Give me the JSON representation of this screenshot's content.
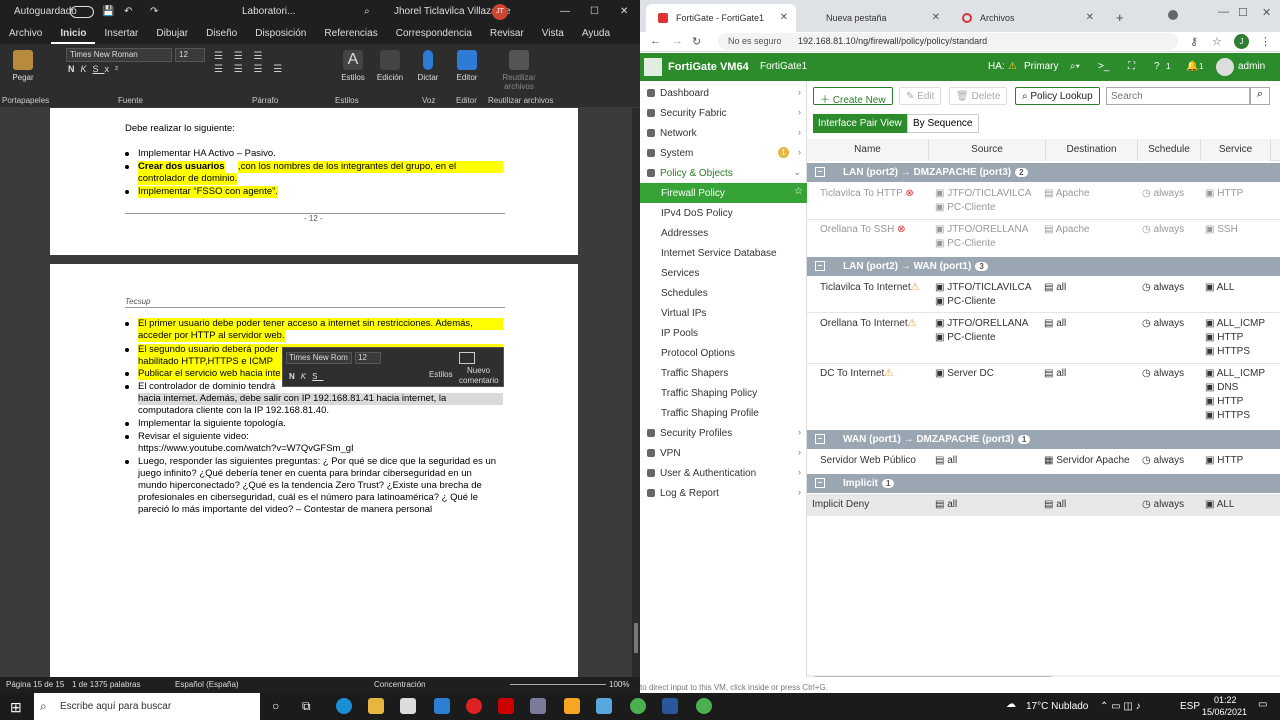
{
  "word": {
    "title": {
      "autosave": "Autoguardado",
      "doc": "Laboratori...",
      "user": "Jhorel Ticlavilca Villazante",
      "initials": "JT"
    },
    "tabs": [
      "Archivo",
      "Inicio",
      "Insertar",
      "Dibujar",
      "Diseño",
      "Disposición",
      "Referencias",
      "Correspondencia",
      "Revisar",
      "Vista",
      "Ayuda"
    ],
    "ribbon": {
      "paste": "Pegar",
      "font_name": "Times New Roman",
      "font_size": "12",
      "styles": "Estilos",
      "edit": "Edición",
      "dictate": "Dictar",
      "editor": "Editor",
      "reuse": "Reutilizar archivos",
      "groups": [
        "Portapapeles",
        "Fuente",
        "Párrafo",
        "Estilos",
        "Voz",
        "Editor",
        "Reutilizar archivos"
      ]
    },
    "page1": {
      "intro": "Debe realizar lo siguiente:",
      "b1": "Implementar HA Activo – Pasivo.",
      "b2a": "Crear dos usuarios",
      "b2b": " ,con los nombres de los integrantes del grupo, en el",
      "b2c": "controlador de dominio.",
      "b3": "Implementar “FSSO con agente”.",
      "pagenum": "- 12 -"
    },
    "page2": {
      "header": "Tecsup",
      "l1": "El primer usuario debe poder tener acceso a internet sin restricciones. Además,",
      "l2": "acceder por HTTP al servidor web.",
      "l3": "El segundo usuario deberá poder",
      "l4": "habilitado HTTP,HTTPS e ICMP",
      "l5": "Publicar el servicio web hacia inte",
      "l6": "El controlador de dominio tendrá",
      "l7": "hacia internet. Además, debe salir con IP 192.168.81.41 hacia internet, la",
      "l8": "computadora cliente con la IP 192.168.81.40.",
      "l9": "Implementar la siguiente topología.",
      "l10": "Revisar el siguiente video:",
      "l11": "https://www.youtube.com/watch?v=W7QvGFSm_gI",
      "l12": "Luego, responder las siguientes preguntas: ¿ Por qué se dice que la seguridad es un",
      "l13": "juego infinito? ¿Qué debería tener en cuenta para brindar ciberseguridad en un",
      "l14": "mundo hiperconectado? ¿Qué es la tendencia Zero Trust? ¿Existe una brecha de",
      "l15": "profesionales en ciberseguridad, cuál es el número para latinoamérica? ¿ Qué le",
      "l16": "pareció lo más importante del video? – Contestar de manera personal"
    },
    "minibar": {
      "font": "Times New Rom",
      "size": "12",
      "styles": "Estilos",
      "comment1": "Nuevo",
      "comment2": "comentario"
    },
    "status": {
      "page": "Página 15 de 15",
      "words": "1 de 1375 palabras",
      "lang": "Español (España)",
      "focus": "Concentración",
      "zoom": "100%"
    }
  },
  "chrome": {
    "tabs": [
      {
        "label": "FortiGate - FortiGate1"
      },
      {
        "label": "Nueva pestaña"
      },
      {
        "label": "Archivos"
      }
    ],
    "insecure": "No es seguro",
    "url": "192.168.81.10/ng/firewall/policy/policy/standard",
    "profile": "J"
  },
  "fortigate": {
    "brand": "FortiGate VM64",
    "host": "FortiGate1",
    "ha": "HA:",
    "ha_role": "Primary",
    "help_badge": "1",
    "notif": "1",
    "user": "admin",
    "sidebar": [
      {
        "label": "Dashboard",
        "type": "top"
      },
      {
        "label": "Security Fabric",
        "type": "top"
      },
      {
        "label": "Network",
        "type": "top"
      },
      {
        "label": "System",
        "type": "top",
        "badge": "1"
      },
      {
        "label": "Policy & Objects",
        "type": "top",
        "open": true
      },
      {
        "label": "Firewall Policy",
        "type": "sub",
        "selected": true
      },
      {
        "label": "IPv4 DoS Policy",
        "type": "sub"
      },
      {
        "label": "Addresses",
        "type": "sub"
      },
      {
        "label": "Internet Service Database",
        "type": "sub"
      },
      {
        "label": "Services",
        "type": "sub"
      },
      {
        "label": "Schedules",
        "type": "sub"
      },
      {
        "label": "Virtual IPs",
        "type": "sub"
      },
      {
        "label": "IP Pools",
        "type": "sub"
      },
      {
        "label": "Protocol Options",
        "type": "sub"
      },
      {
        "label": "Traffic Shapers",
        "type": "sub"
      },
      {
        "label": "Traffic Shaping Policy",
        "type": "sub"
      },
      {
        "label": "Traffic Shaping Profile",
        "type": "sub"
      },
      {
        "label": "Security Profiles",
        "type": "top"
      },
      {
        "label": "VPN",
        "type": "top"
      },
      {
        "label": "User & Authentication",
        "type": "top"
      },
      {
        "label": "Log & Report",
        "type": "top"
      }
    ],
    "toolbar": {
      "create": "Create New",
      "edit": "Edit",
      "delete": "Delete",
      "lookup": "Policy Lookup",
      "search_placeholder": "Search"
    },
    "views": {
      "pair": "Interface Pair View",
      "seq": "By Sequence"
    },
    "columns": [
      "Name",
      "Source",
      "Destination",
      "Schedule",
      "Service"
    ],
    "groups": [
      {
        "title": "LAN (port2) → DMZAPACHE (port3)",
        "count": "2"
      },
      {
        "title": "LAN (port2) → WAN (port1)",
        "count": "3"
      },
      {
        "title": "WAN (port1) → DMZAPACHE (port3)",
        "count": "1"
      },
      {
        "title": "Implicit",
        "count": "1"
      }
    ],
    "rows": {
      "r1": {
        "name": "Ticlavilca To HTTP",
        "src1": "JTFO/TICLAVILCA",
        "src2": "PC-Cliente",
        "dst": "Apache",
        "sch": "always",
        "svc": "HTTP"
      },
      "r2": {
        "name": "Orellana To SSH",
        "src1": "JTFO/ORELLANA",
        "src2": "PC-Cliente",
        "dst": "Apache",
        "sch": "always",
        "svc": "SSH"
      },
      "r3": {
        "name": "Ticlavilca To Internet",
        "src1": "JTFO/TICLAVILCA",
        "src2": "PC-Cliente",
        "dst": "all",
        "sch": "always",
        "svc": "ALL"
      },
      "r4": {
        "name": "Orellana To Internet",
        "src1": "JTFO/ORELLANA",
        "src2": "PC-Cliente",
        "dst": "all",
        "sch": "always",
        "svc1": "ALL_ICMP",
        "svc2": "HTTP",
        "svc3": "HTTPS"
      },
      "r5": {
        "name": "DC To Internet",
        "src1": "Server DC",
        "dst": "all",
        "sch": "always",
        "svc1": "ALL_ICMP",
        "svc2": "DNS",
        "svc3": "HTTP",
        "svc4": "HTTPS"
      },
      "r6": {
        "name": "Servidor Web Público",
        "src1": "all",
        "dst": "Servidor Apache",
        "sch": "always",
        "svc": "HTTP"
      },
      "r7": {
        "name": "Implicit Deny",
        "src1": "all",
        "dst": "all",
        "sch": "always",
        "svc": "ALL"
      }
    },
    "vm_hint": "to direct input to this VM, click inside or press Ctrl+G."
  },
  "taskbar": {
    "search": "Escribe aquí para buscar",
    "weather": "17°C  Nublado",
    "lang": "ESP",
    "time": "01:22",
    "date": "15/06/2021"
  }
}
